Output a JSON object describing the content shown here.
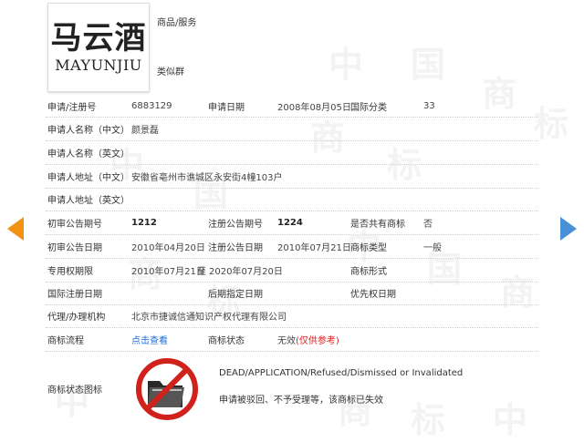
{
  "watermark": [
    "中",
    "国",
    "商",
    "标"
  ],
  "logo": {
    "cn_text": "马云酒",
    "en_text": "MAYUNJIU"
  },
  "top": {
    "goods_label": "商品/服务",
    "similar_label": "类似群"
  },
  "rows": {
    "reg_no": {
      "label": "申请/注册号",
      "value": "6883129",
      "date_label": "申请日期",
      "date_value": "2008年08月05日",
      "class_label": "国际分类",
      "class_value": "33"
    },
    "applicant_cn": {
      "label": "申请人名称（中文）",
      "value": "颜景磊"
    },
    "applicant_en": {
      "label": "申请人名称（英文）",
      "value": ""
    },
    "address_cn": {
      "label": "申请人地址（中文）",
      "value": "安徽省亳州市谯城区永安街4幢103户"
    },
    "address_en": {
      "label": "申请人地址（英文）",
      "value": ""
    },
    "prelim_no": {
      "label": "初审公告期号",
      "value": "1212",
      "reg_label": "注册公告期号",
      "reg_value": "1224",
      "shared_label": "是否共有商标",
      "shared_value": "否"
    },
    "prelim_date": {
      "label": "初审公告日期",
      "value": "2010年04月20日",
      "reg_label": "注册公告日期",
      "reg_value": "2010年07月21日",
      "type_label": "商标类型",
      "type_value": "一般"
    },
    "exclusive": {
      "label": "专用权期限",
      "start": "2010年07月21日",
      "sep": "至",
      "end": "2020年07月20日",
      "form_label": "商标形式",
      "form_value": ""
    },
    "intl": {
      "label": "国际注册日期",
      "late_label": "后期指定日期",
      "priority_label": "优先权日期"
    },
    "agent": {
      "label": "代理/办理机构",
      "value": "北京市捷诚信通知识产权代理有限公司"
    },
    "process": {
      "label": "商标流程",
      "link": "点击查看",
      "status_label": "商标状态",
      "status_value": "无效",
      "status_note": "(仅供参考)"
    },
    "status_icon": {
      "label": "商标状态图标",
      "en": "DEAD/APPLICATION/Refused/Dismissed or Invalidated",
      "cn": "申请被驳回、不予受理等，该商标已失效"
    }
  },
  "colors": {
    "arrow_left": "#f29112",
    "arrow_right": "#4a90d6",
    "link": "#1a6fd6",
    "status_red": "#e01b1b"
  },
  "icons": {
    "prev": "arrow-left-icon",
    "next": "arrow-right-icon",
    "status": "prohibited-folder-icon"
  }
}
